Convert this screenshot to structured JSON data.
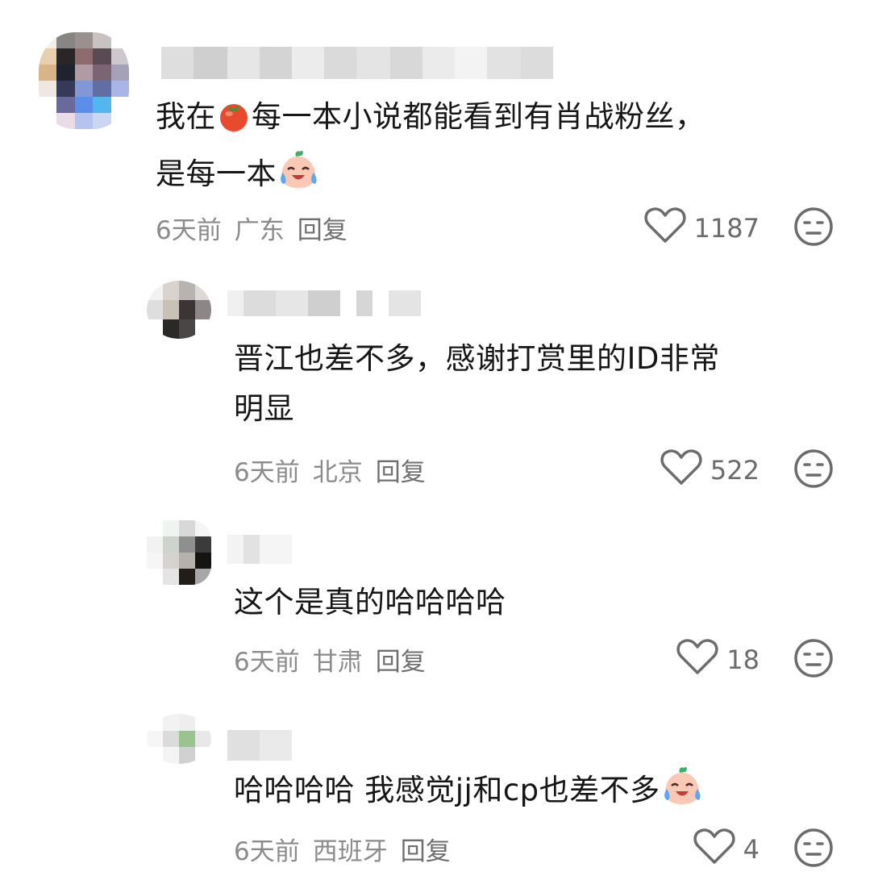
{
  "comments": [
    {
      "text_before": "我在",
      "text_inline_icon": "tomato-icon",
      "text_after": "每一本小说都能看到有肖战粉丝，\n是每一本",
      "text_end_icon": "crying-laugh-emoji",
      "time": "6天前",
      "location": "广东",
      "reply_label": "回复",
      "likes": "1187"
    },
    {
      "text": "晋江也差不多，感谢打赏里的ID非常\n明显",
      "time": "6天前",
      "location": "北京",
      "reply_label": "回复",
      "likes": "522"
    },
    {
      "text": "这个是真的哈哈哈哈",
      "time": "6天前",
      "location": "甘肃",
      "reply_label": "回复",
      "likes": "18"
    },
    {
      "text": "哈哈哈哈 我感觉jj和cp也差不多",
      "text_end_icon": "crying-laugh-emoji",
      "time": "6天前",
      "location": "西班牙",
      "reply_label": "回复",
      "likes": "4"
    }
  ],
  "icons": {
    "like": "heart-outline-icon",
    "dislike": "meh-face-icon"
  },
  "colors": {
    "text": "#161616",
    "meta": "#8b8b8b",
    "icon": "#6c6c6c"
  }
}
